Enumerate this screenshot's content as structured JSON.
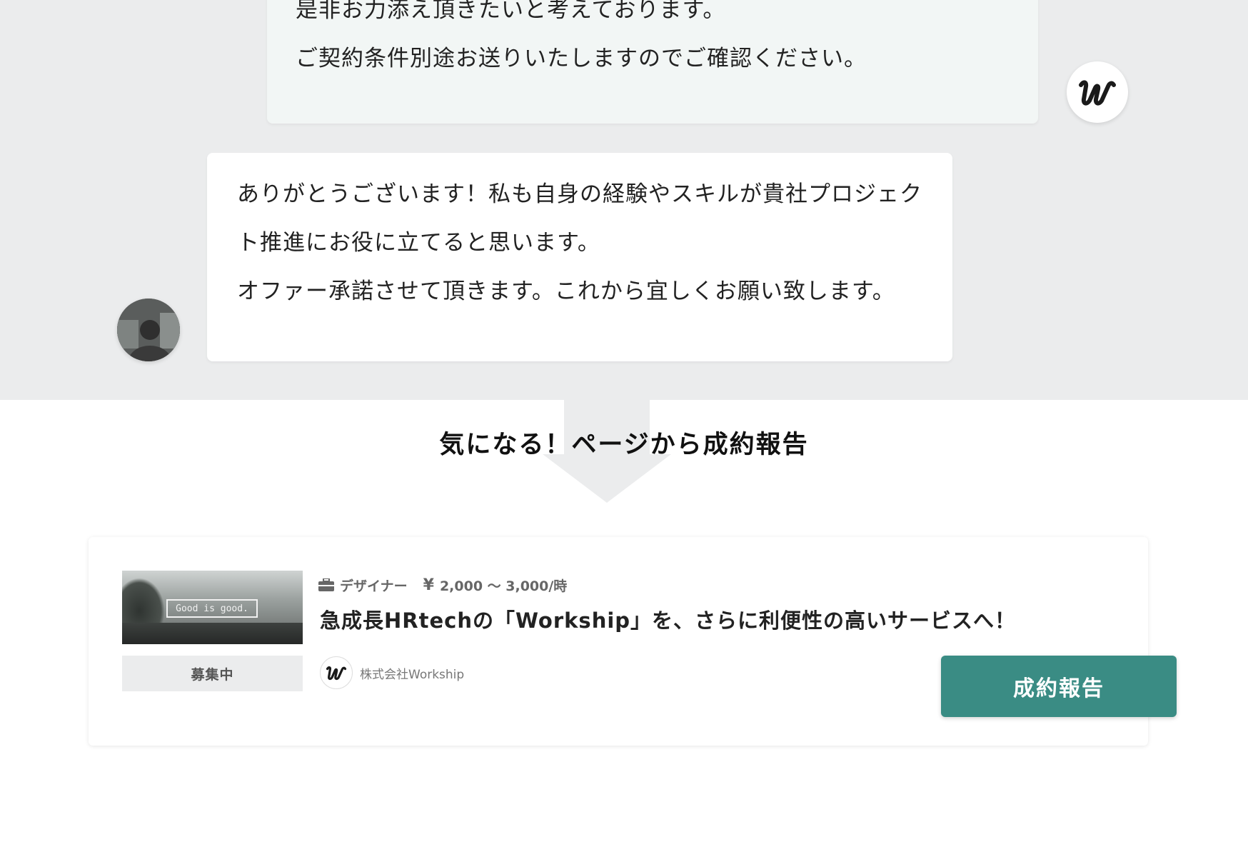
{
  "chat": {
    "company_message": {
      "lines": [
        "是非お力添え頂きたいと考えております。",
        "ご契約条件別途お送りいたしますのでご確認ください。"
      ],
      "avatar_icon": "workship-logo-icon"
    },
    "user_message": {
      "lines": [
        "ありがとうございます！私も自身の経験やスキルが貴社プロジェク",
        "ト推進にお役に立てると思います。",
        "オファー承諾させて頂きます。これから宜しくお願い致します。"
      ],
      "avatar_icon": "user-avatar-photo"
    }
  },
  "section": {
    "title": "気になる！ページから成約報告"
  },
  "job_card": {
    "thumbnail_sign_text": "Good is good.",
    "status": "募集中",
    "category_icon": "briefcase-icon",
    "category": "デザイナー",
    "currency_symbol": "¥",
    "rate": "2,000 〜 3,000/時",
    "title": "急成長HRtechの「Workship」を、さらに利便性の高いサービスへ！",
    "company_name": "株式会社Workship"
  },
  "actions": {
    "report_button_label": "成約報告"
  },
  "colors": {
    "chat_background": "#ebeced",
    "company_bubble": "#f2f6f5",
    "user_bubble": "#ffffff",
    "accent_button": "#3a8c84"
  }
}
